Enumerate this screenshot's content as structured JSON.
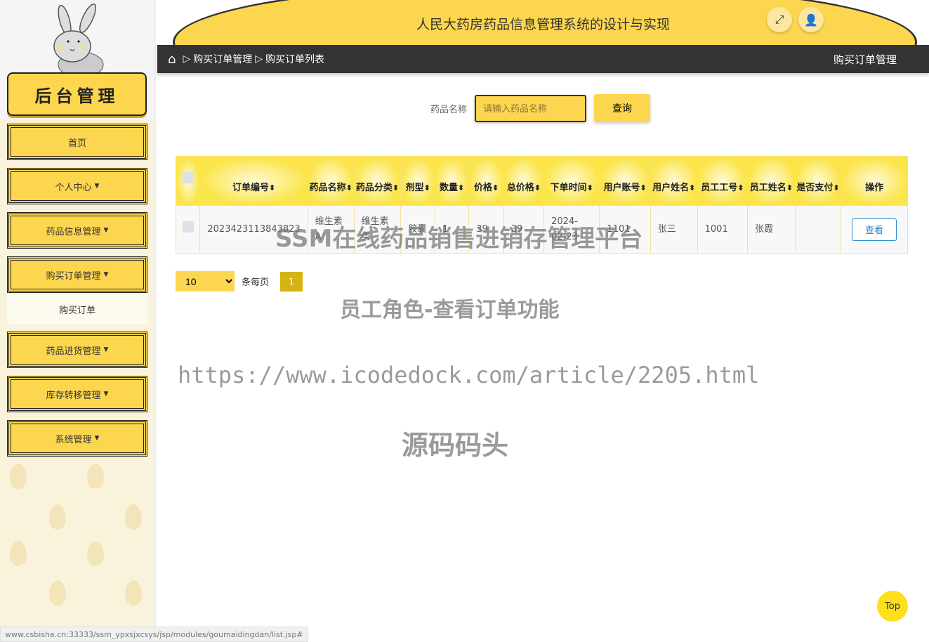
{
  "sidebar": {
    "brand": "后台管理",
    "items": [
      {
        "label": "首页",
        "caret": false
      },
      {
        "label": "个人中心",
        "caret": true
      },
      {
        "label": "药品信息管理",
        "caret": true
      },
      {
        "label": "购买订单管理",
        "caret": true
      },
      {
        "label": "药品进货管理",
        "caret": true
      },
      {
        "label": "库存转移管理",
        "caret": true
      },
      {
        "label": "系统管理",
        "caret": true
      }
    ],
    "sub_item": "购买订单"
  },
  "header": {
    "title": "人民大药房药品信息管理系统的设计与实现",
    "fullscreen_icon": "expand-icon",
    "user_icon": "user-icon"
  },
  "breadcrumb": {
    "home_icon": "home-icon",
    "items": [
      "购买订单管理",
      "购买订单列表"
    ],
    "right": "购买订单管理"
  },
  "search": {
    "label": "药品名称",
    "placeholder": "请输入药品名称",
    "value": "",
    "button": "查询"
  },
  "table": {
    "headers": [
      "订单编号",
      "药品名称",
      "药品分类",
      "剂型",
      "数量",
      "价格",
      "总价格",
      "下单时间",
      "用户账号",
      "用户姓名",
      "员工工号",
      "员工姓名",
      "是否支付",
      "操作"
    ],
    "rows": [
      {
        "cells": [
          "2023423113843823",
          "维生素A",
          "维生素类",
          "胶囊",
          "1",
          "39",
          "39",
          "2024-02-23",
          "1101",
          "张三",
          "1001",
          "张霞",
          ""
        ],
        "action": "查看"
      }
    ]
  },
  "pager": {
    "page_size": "10",
    "per_page_label": "条每页",
    "current_page": "1"
  },
  "watermarks": [
    "SSM在线药品销售进销存管理平台",
    "员工角色-查看订单功能",
    "https://www.icodedock.com/article/2205.html",
    "源码码头"
  ],
  "top_button": "Top",
  "status_url": "www.csbishe.cn:33333/ssm_ypxsjxcsys/jsp/modules/goumaidingdan/list.jsp#",
  "colors": {
    "accent": "#fdd64f",
    "dark": "#333333",
    "link": "#2a8ad0"
  }
}
